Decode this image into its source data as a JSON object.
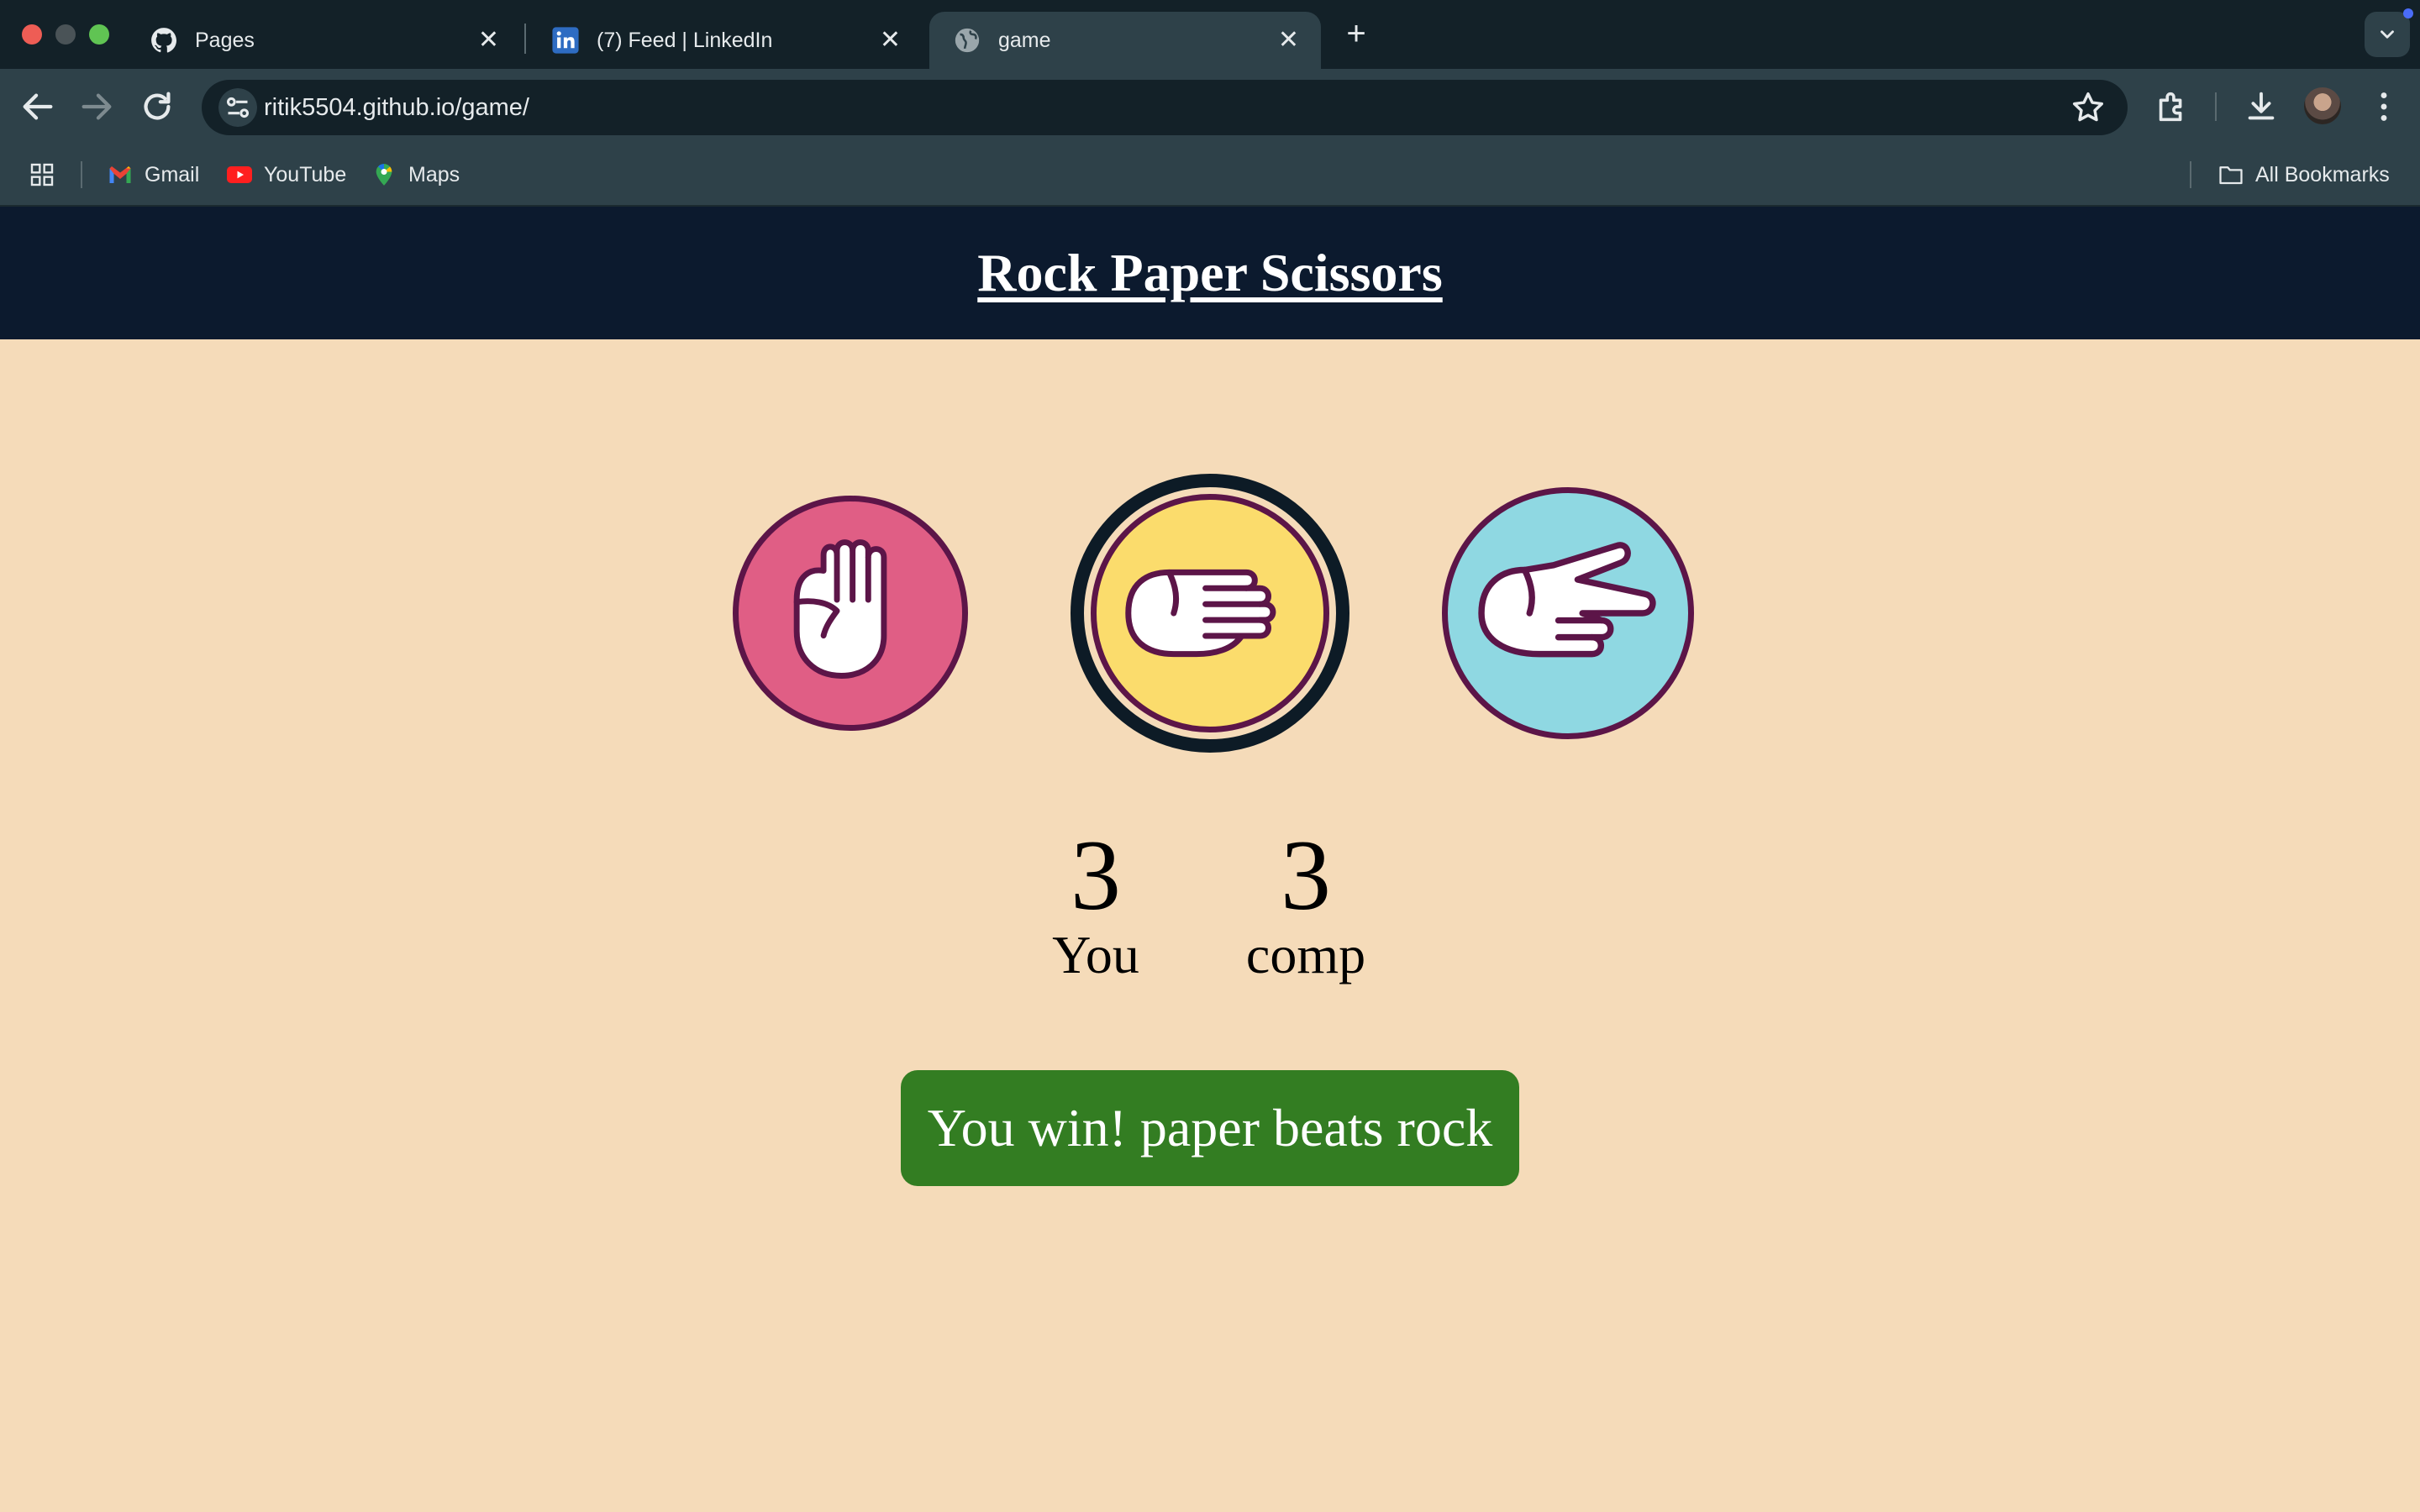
{
  "browser": {
    "tabs": [
      {
        "title": "Pages",
        "icon": "github-icon",
        "active": false
      },
      {
        "title": "(7) Feed | LinkedIn",
        "icon": "linkedin-icon",
        "active": false
      },
      {
        "title": "game",
        "icon": "globe-icon",
        "active": true
      }
    ],
    "new_tab_label": "+",
    "close_label": "✕",
    "url": "ritik5504.github.io/game/",
    "bookmarks": [
      {
        "label": "Gmail",
        "icon": "gmail-icon"
      },
      {
        "label": "YouTube",
        "icon": "youtube-icon"
      },
      {
        "label": "Maps",
        "icon": "maps-icon"
      }
    ],
    "all_bookmarks_label": "All Bookmarks"
  },
  "game": {
    "title": "Rock Paper Scissors",
    "choices": [
      {
        "id": "rock",
        "icon": "rock-fist-icon",
        "color": "#e05e85"
      },
      {
        "id": "paper",
        "icon": "paper-hand-icon",
        "color": "#fbdc6c",
        "selected": true
      },
      {
        "id": "scissors",
        "icon": "scissors-hand-icon",
        "color": "#8fd8e2"
      }
    ],
    "scores": {
      "you": {
        "value": "3",
        "label": "You"
      },
      "comp": {
        "value": "3",
        "label": "comp"
      }
    },
    "message": "You win! paper beats rock",
    "message_color": "#337d22"
  },
  "colors": {
    "page_bg": "#f5dbb9",
    "header_bg": "#0c1a2e",
    "outline": "#5c1548"
  }
}
